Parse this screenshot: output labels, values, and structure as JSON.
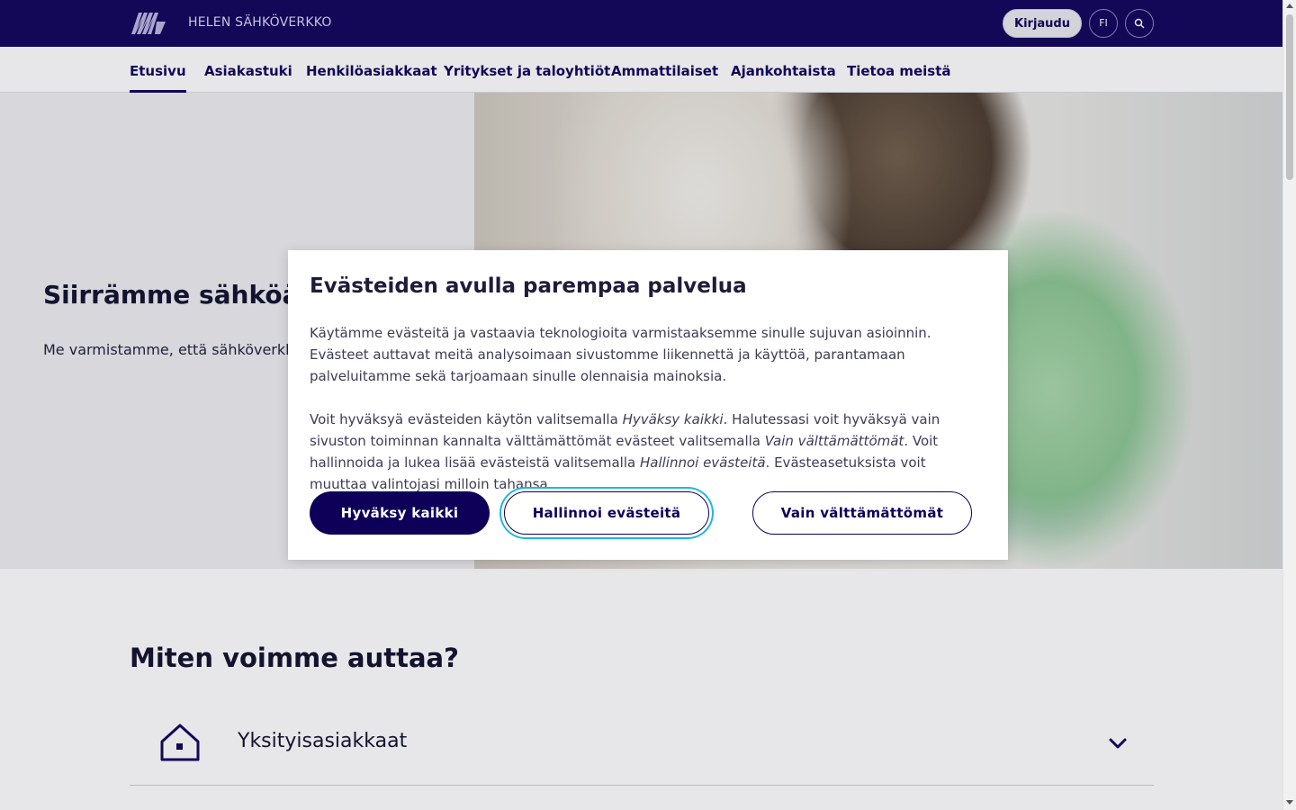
{
  "header": {
    "brand": "HELEN SÄHKÖVERKKO",
    "login_label": "Kirjaudu",
    "language_label": "FI",
    "search_icon": "search-icon",
    "logo_icon": "helen-logo"
  },
  "nav": {
    "items": [
      {
        "label": "Etusivu",
        "active": true
      },
      {
        "label": "Asiakastuki"
      },
      {
        "label": "Henkilöasiakkaat"
      },
      {
        "label": "Yritykset ja taloyhtiöt"
      },
      {
        "label": "Ammattilaiset"
      },
      {
        "label": "Ajankohtaista"
      },
      {
        "label": "Tietoa meistä"
      }
    ]
  },
  "hero": {
    "title": "Siirrämme sähköä He",
    "text": "Me varmistamme, että sähköverkko kaikissa olosuhteissa."
  },
  "help": {
    "title": "Miten voimme auttaa?",
    "accordion": {
      "label": "Yksityisasiakkaat",
      "icon": "house-icon",
      "chevron": "chevron-down-icon"
    }
  },
  "cookie_dialog": {
    "title": "Evästeiden avulla parempaa palvelua",
    "paragraph1": "Käytämme evästeitä ja vastaavia teknologioita varmistaaksemme sinulle sujuvan asioinnin. Evästeet auttavat meitä analysoimaan sivustomme liikennettä ja käyttöä, parantamaan palveluitamme sekä tarjoamaan sinulle olennaisia mainoksia.",
    "paragraph2": {
      "part1": "Voit hyväksyä evästeiden käytön valitsemalla ",
      "em1": "Hyväksy kaikki",
      "part2": ". Halutessasi voit hyväksyä vain sivuston toiminnan kannalta välttämättömät evästeet valitsemalla ",
      "em2": "Vain välttämättömät",
      "part3": ". Voit hallinnoida ja lukea lisää evästeistä valitsemalla ",
      "em3": "Hallinnoi evästeitä",
      "part4": ". Evästeasetuksista voit muuttaa valintojasi milloin tahansa."
    },
    "accept_label": "Hyväksy kaikki",
    "manage_label": "Hallinnoi evästeitä",
    "necessary_label": "Vain välttämättömät"
  },
  "colors": {
    "brand_navy": "#0e0059",
    "focus_ring": "#1fb6e0"
  }
}
